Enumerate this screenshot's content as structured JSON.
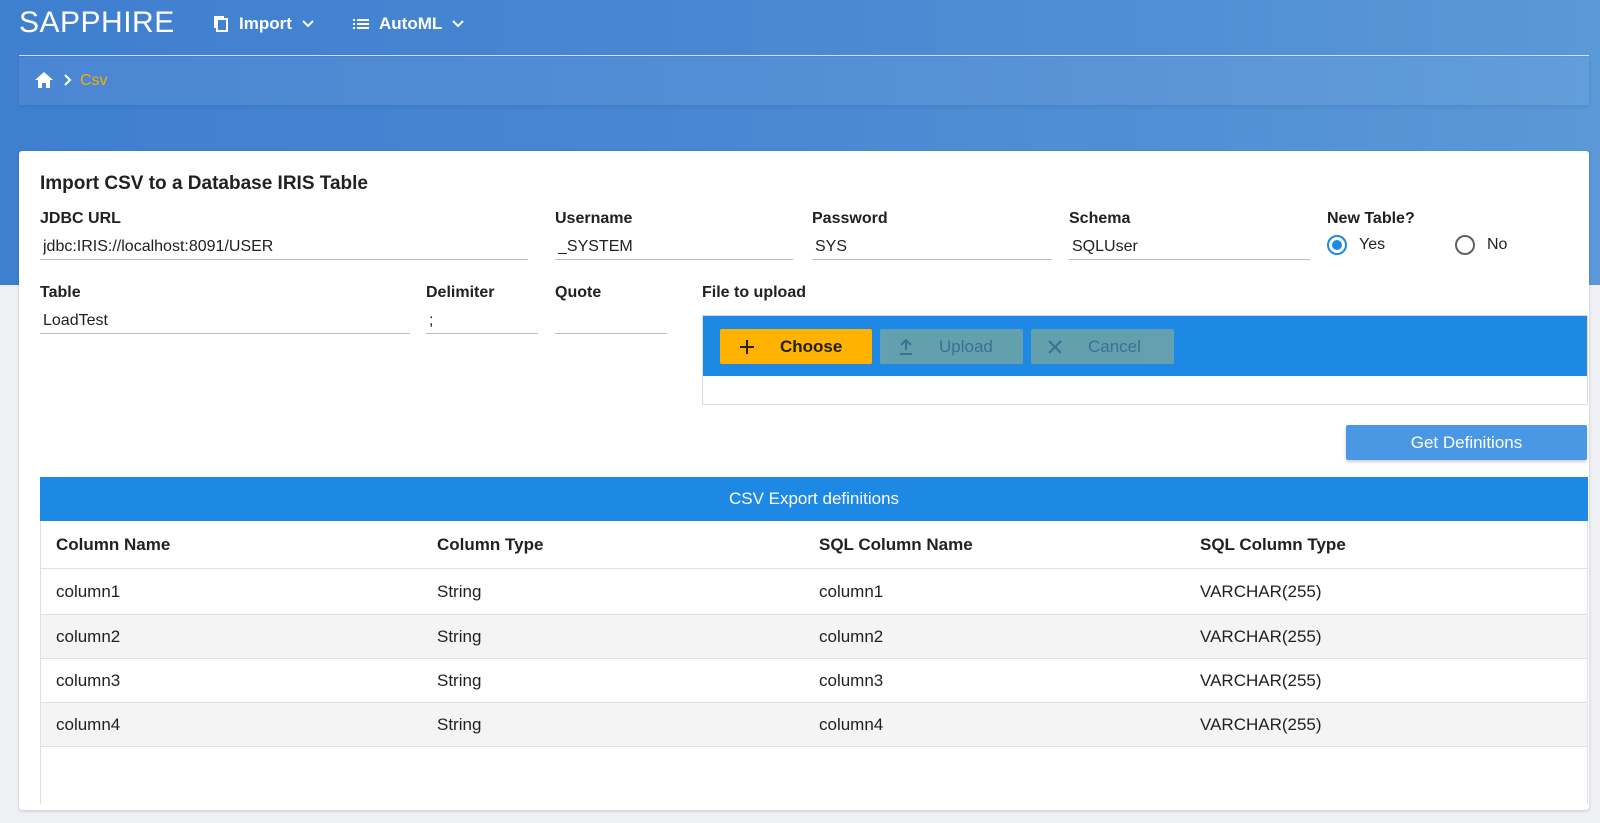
{
  "app": {
    "brand": "SAPPHIRE"
  },
  "nav": {
    "import_label": "Import",
    "automl_label": "AutoML"
  },
  "breadcrumb": {
    "current": "Csv"
  },
  "form": {
    "title": "Import CSV to a Database IRIS Table",
    "jdbc_label": "JDBC URL",
    "jdbc_value": "jdbc:IRIS://localhost:8091/USER",
    "username_label": "Username",
    "username_value": "_SYSTEM",
    "password_label": "Password",
    "password_value": "SYS",
    "schema_label": "Schema",
    "schema_value": "SQLUser",
    "newtable_label": "New Table?",
    "newtable_yes": "Yes",
    "newtable_no": "No",
    "newtable_selected": "Yes",
    "table_label": "Table",
    "table_value": "LoadTest",
    "delimiter_label": "Delimiter",
    "delimiter_value": ";",
    "quote_label": "Quote",
    "quote_value": "",
    "file_label": "File to upload"
  },
  "upload": {
    "choose_label": "Choose",
    "upload_label": "Upload",
    "cancel_label": "Cancel"
  },
  "get_definitions_label": "Get Definitions",
  "table": {
    "caption": "CSV Export definitions",
    "columns": [
      "Column Name",
      "Column Type",
      "SQL Column Name",
      "SQL Column Type"
    ],
    "rows": [
      [
        "column1",
        "String",
        "column1",
        "VARCHAR(255)"
      ],
      [
        "column2",
        "String",
        "column2",
        "VARCHAR(255)"
      ],
      [
        "column3",
        "String",
        "column3",
        "VARCHAR(255)"
      ],
      [
        "column4",
        "String",
        "column4",
        "VARCHAR(255)"
      ]
    ]
  },
  "colors": {
    "primary": "#1e88e5",
    "accent": "#ffb300",
    "breadcrumb_active": "#f5b000"
  },
  "icons": {
    "import": "copy-icon",
    "automl": "list-icon",
    "home": "home-icon",
    "choose": "plus-icon",
    "upload": "upload-icon",
    "cancel": "close-icon"
  }
}
